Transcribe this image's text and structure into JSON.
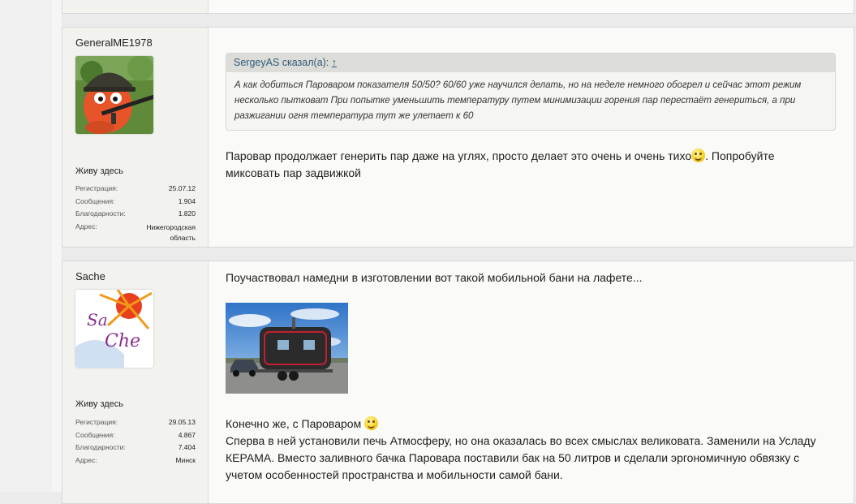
{
  "posts": [
    {
      "username": "GeneralME1978",
      "avatar": "avatar-cartoon-soldier",
      "user_title": "Живу здесь",
      "stats": [
        {
          "label": "Регистрация:",
          "value": "25.07.12"
        },
        {
          "label": "Сообщения:",
          "value": "1.904"
        },
        {
          "label": "Благодарности:",
          "value": "1.820"
        },
        {
          "label": "Адрес:",
          "value": "Нижегородская область"
        }
      ],
      "quote": {
        "author": "SergeyAS сказал(а):",
        "arrow": "↑",
        "text": "А как добиться Пароваром показателя 50/50? 60/60 уже научился делать, но на неделе немного обогрел и сейчас этот режим несколько пытковат При попытке уменьшить температуру путем минимизации горения пар перестаёт генериться, а при разжигании огня температура тут же улетает к 60"
      },
      "message_before_smiley": "Паровар продолжает генерить пар даже на углях, просто делает это очень и очень тихо",
      "message_after_smiley": ". Попробуйте миксовать пар задвижкой"
    },
    {
      "username": "Sache",
      "avatar": "avatar-sache-sun-logo",
      "avatar_text_1": "Sa",
      "avatar_text_2": "Che",
      "user_title": "Живу здесь",
      "stats": [
        {
          "label": "Регистрация:",
          "value": "29.05.13"
        },
        {
          "label": "Сообщения:",
          "value": "4.867"
        },
        {
          "label": "Благодарности:",
          "value": "7.404"
        },
        {
          "label": "Адрес:",
          "value": "Минск"
        }
      ],
      "intro": "Поучаствовал намедни в изготовлении вот такой мобильной бани на лафете...",
      "image": "photo-mobile-sauna-trailer",
      "line1": "Конечно же, с Пароваром ",
      "line2": "Сперва в ней установили печь Атмосферу, но она оказалась во всех смыслах великовата. Заменили на Усладу КЕРАМА. Вместо заливного бачка Паровара поставили бак на 50 литров и сделали эргономичную обвязку с учетом особенностей пространства и мобильности самой бани."
    }
  ]
}
